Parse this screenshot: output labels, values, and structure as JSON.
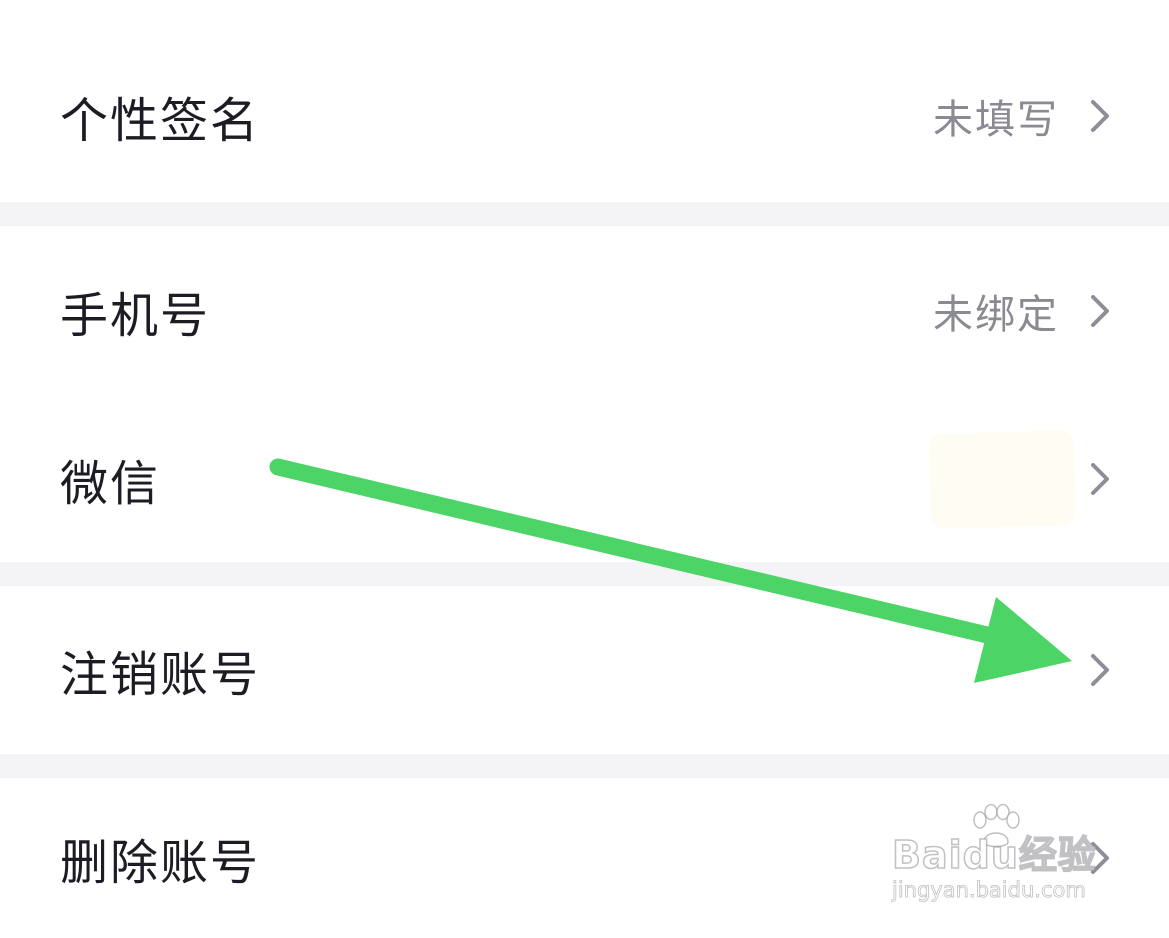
{
  "settings": {
    "rows": [
      {
        "label": "个性签名",
        "value": "未填写"
      },
      {
        "label": "手机号",
        "value": "未绑定"
      },
      {
        "label": "微信",
        "value": ""
      },
      {
        "label": "注销账号",
        "value": ""
      },
      {
        "label": "删除账号",
        "value": ""
      }
    ]
  },
  "icons": {
    "chevron": "chevron-right-icon"
  },
  "colors": {
    "background": "#ffffff",
    "divider": "#f4f4f6",
    "label": "#1c1c24",
    "value": "#8a8a92",
    "chevron": "#8e8e98",
    "annotation_arrow": "#4cd466"
  },
  "watermark": {
    "logo_text": "Baidu经验",
    "url": "jingyan.baidu.com"
  }
}
